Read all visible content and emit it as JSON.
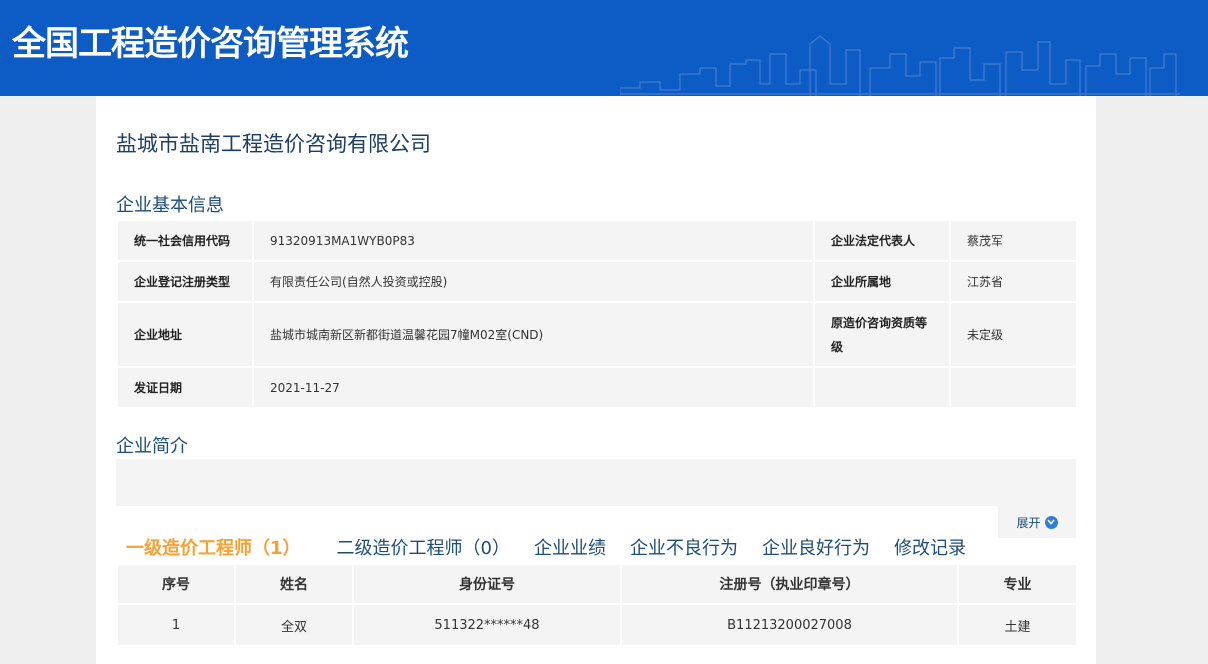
{
  "header": {
    "system_title": "全国工程造价咨询管理系统"
  },
  "company": {
    "name": "盐城市盐南工程造价咨询有限公司"
  },
  "basic_info": {
    "section_title": "企业基本信息",
    "rows": [
      {
        "label1": "统一社会信用代码",
        "value1": "91320913MA1WYB0P83",
        "label2": "企业法定代表人",
        "value2": "蔡茂军"
      },
      {
        "label1": "企业登记注册类型",
        "value1": "有限责任公司(自然人投资或控股)",
        "label2": "企业所属地",
        "value2": "江苏省"
      },
      {
        "label1": "企业地址",
        "value1": "盐城市城南新区新都街道温馨花园7幢M02室(CND)",
        "label2": "原造价咨询资质等级",
        "value2": "未定级"
      },
      {
        "label1": "发证日期",
        "value1": "2021-11-27",
        "label2": "",
        "value2": ""
      }
    ]
  },
  "intro": {
    "section_title": "企业简介",
    "expand_label": "展开"
  },
  "tabs": [
    {
      "label": "一级造价工程师（1）",
      "active": true
    },
    {
      "label": "二级造价工程师（0）",
      "active": false
    },
    {
      "label": "企业业绩",
      "active": false
    },
    {
      "label": "企业不良行为",
      "active": false
    },
    {
      "label": "企业良好行为",
      "active": false
    },
    {
      "label": "修改记录",
      "active": false
    }
  ],
  "engineers": {
    "columns": [
      "序号",
      "姓名",
      "身份证号",
      "注册号（执业印章号）",
      "专业"
    ],
    "rows": [
      [
        "1",
        "全双",
        "511322******48",
        "B11213200027008",
        "土建"
      ]
    ]
  },
  "colors": {
    "header_bg": "#0d5bc5",
    "active_tab": "#f5a233",
    "link": "#1d4e7a",
    "cell_bg": "#f4f4f5"
  }
}
